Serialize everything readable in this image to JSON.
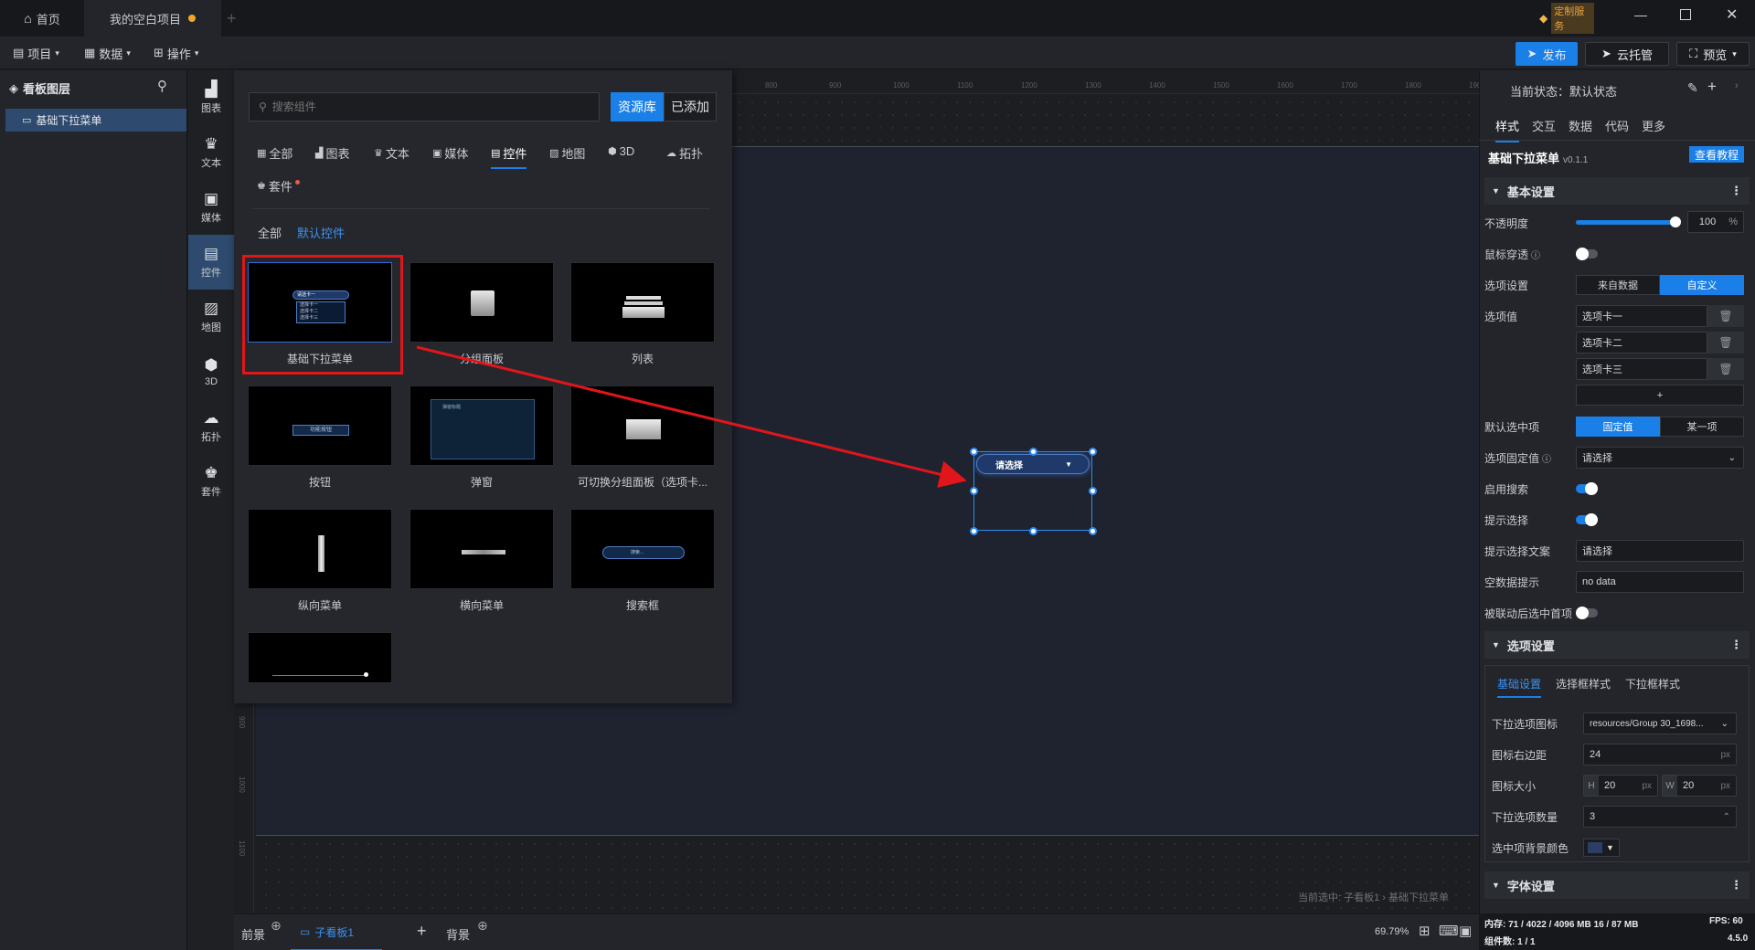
{
  "titlebar": {
    "home_label": "首页",
    "project_tab": "我的空白项目",
    "new_tab_icon": "plus-icon",
    "custom_service": "定制服务"
  },
  "menubar": {
    "project": "项目",
    "data": "数据",
    "operate": "操作",
    "publish": "发布",
    "cloud": "云托管",
    "preview": "预览"
  },
  "layers": {
    "title": "看板图层",
    "item": "基础下拉菜单"
  },
  "iconbar": [
    {
      "label": "图表",
      "icon": "chart-icon"
    },
    {
      "label": "文本",
      "icon": "text-icon"
    },
    {
      "label": "媒体",
      "icon": "media-icon"
    },
    {
      "label": "控件",
      "icon": "widget-icon"
    },
    {
      "label": "地图",
      "icon": "map-icon"
    },
    {
      "label": "3D",
      "icon": "cube-icon"
    },
    {
      "label": "拓扑",
      "icon": "topology-icon"
    },
    {
      "label": "套件",
      "icon": "kit-icon"
    }
  ],
  "panel": {
    "search_placeholder": "搜索组件",
    "library": "资源库",
    "added": "已添加",
    "categories": [
      "全部",
      "图表",
      "文本",
      "媒体",
      "控件",
      "地图",
      "3D",
      "拓扑"
    ],
    "cat_kit": "套件",
    "sub_all": "全部",
    "sub_default": "默认控件",
    "cards": [
      "基础下拉菜单",
      "分组面板",
      "列表",
      "按钮",
      "弹窗",
      "可切换分组面板（选项卡...",
      "纵向菜单",
      "横向菜单",
      "搜索框"
    ],
    "thumb_dropdown_items": [
      "请选卡一",
      "选择卡一",
      "选择卡二",
      "选择卡三"
    ],
    "thumb_button": "功能按钮",
    "thumb_dialog": "弹窗标题",
    "thumb_search": "搜索..."
  },
  "ruler": [
    "800",
    "900",
    "1000",
    "1100",
    "1200",
    "1300",
    "1400",
    "1500",
    "1600",
    "1700",
    "1800",
    "1900"
  ],
  "vruler": [
    "900",
    "1000",
    "1100"
  ],
  "canvas": {
    "widget_text": "请选择",
    "breadcrumb": "当前选中: 子看板1 › 基础下拉菜单"
  },
  "right": {
    "state": "当前状态：默认状态",
    "tabs": [
      "样式",
      "交互",
      "数据",
      "代码",
      "更多"
    ],
    "comp_name": "基础下拉菜单",
    "version": "v0.1.1",
    "tutorial": "查看教程",
    "basic": "基本设置",
    "opacity_label": "不透明度",
    "opacity_value": "100",
    "opacity_unit": "%",
    "opacity_level": 1.0,
    "mouse_through": "鼠标穿透",
    "option_settings": "选项设置",
    "from_data": "来自数据",
    "custom": "自定义",
    "option_values": "选项值",
    "options": [
      "选项卡一",
      "选项卡二",
      "选项卡三"
    ],
    "add": "+",
    "default_selected": "默认选中项",
    "fixed_value": "固定值",
    "some_item": "某一项",
    "option_fixed": "选项固定值",
    "please_select": "请选择",
    "enable_search": "启用搜索",
    "hint_select": "提示选择",
    "hint_text_label": "提示选择文案",
    "hint_text": "请选择",
    "empty_hint_label": "空数据提示",
    "empty_hint": "no data",
    "linked_first": "被联动后选中首项",
    "option_section": "选项设置",
    "sub_tabs": [
      "基础设置",
      "选择框样式",
      "下拉框样式"
    ],
    "dropdown_icon_label": "下拉选项图标",
    "dropdown_icon": "resources/Group 30_1698...",
    "icon_right_label": "图标右边距",
    "icon_right": "24",
    "icon_size_label": "图标大小",
    "h": "H",
    "w": "W",
    "h_val": "20",
    "w_val": "20",
    "px": "px",
    "count_label": "下拉选项数量",
    "count": "3",
    "sel_bg_label": "选中项背景颜色",
    "font_section": "字体设置"
  },
  "bottom": {
    "front": "前景",
    "child": "子看板1",
    "bg": "背景",
    "zoom": "69.79%"
  },
  "status": {
    "memory": "内存:   71 / 4022 / 4096 MB  16 / 87 MB",
    "fps": "FPS:   60",
    "count": "组件数: 1 / 1",
    "ver": "4.5.0"
  },
  "colors": {
    "accent": "#1a7fe6",
    "red": "#e0161b"
  }
}
